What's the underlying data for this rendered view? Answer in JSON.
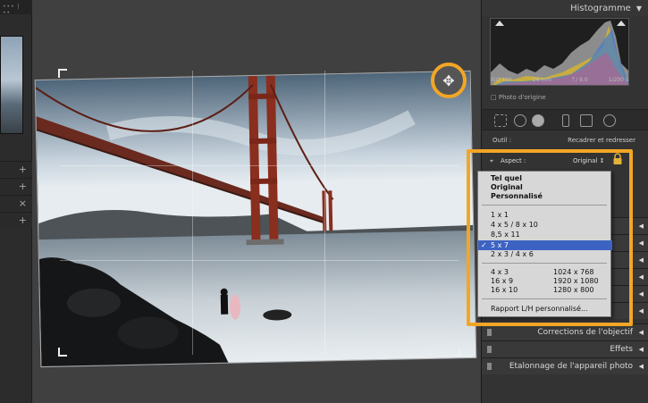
{
  "left_panel": {
    "top_text": "••• | ••",
    "rows": [
      "+",
      "+",
      "×",
      "+"
    ]
  },
  "histogram": {
    "title": "Histogramme",
    "iso": "ISO 400",
    "focal": "24 mm",
    "aperture": "f / 9.0",
    "shutter": "1/200 s",
    "original_photo": "Photo d'origine"
  },
  "tool": {
    "label": "Outil :",
    "value": "Recadrer et redresser"
  },
  "aspect": {
    "label": "Aspect :",
    "value": "Original ↕"
  },
  "menu": {
    "group1": [
      "Tel quel",
      "Original",
      "Personnalisé"
    ],
    "group2": [
      "1 x 1",
      "4 x 5  /  8 x 10",
      "8,5 x 11",
      "5 x 7",
      "2 x 3  /  4 x 6"
    ],
    "selected": "5 x 7",
    "group3_left": [
      "4 x 3",
      "16 x 9",
      "16 x 10"
    ],
    "group3_right": [
      "1024 x 768",
      "1920 x 1080",
      "1280 x 800"
    ],
    "custom": "Rapport L/H personnalisé..."
  },
  "panels": {
    "lens": "Corrections de l'objectif",
    "effects": "Effets",
    "calibration": "Etalonnage de l'appareil photo"
  },
  "colors": {
    "highlight": "#f2a626",
    "menu_select": "#3d63c2"
  },
  "icons": [
    "rotate-icon",
    "lock-icon",
    "crop-icon",
    "check-icon"
  ]
}
